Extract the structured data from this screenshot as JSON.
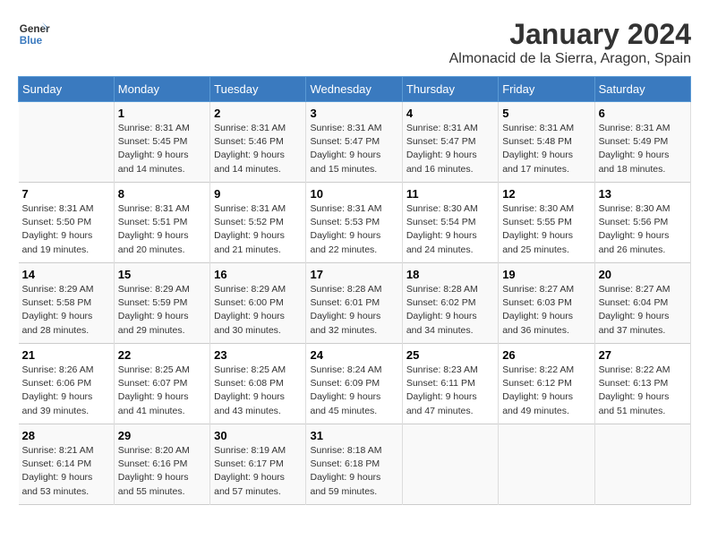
{
  "header": {
    "logo_general": "General",
    "logo_blue": "Blue",
    "month_year": "January 2024",
    "location": "Almonacid de la Sierra, Aragon, Spain"
  },
  "weekdays": [
    "Sunday",
    "Monday",
    "Tuesday",
    "Wednesday",
    "Thursday",
    "Friday",
    "Saturday"
  ],
  "weeks": [
    [
      {
        "day": "",
        "info": ""
      },
      {
        "day": "1",
        "info": "Sunrise: 8:31 AM\nSunset: 5:45 PM\nDaylight: 9 hours\nand 14 minutes."
      },
      {
        "day": "2",
        "info": "Sunrise: 8:31 AM\nSunset: 5:46 PM\nDaylight: 9 hours\nand 14 minutes."
      },
      {
        "day": "3",
        "info": "Sunrise: 8:31 AM\nSunset: 5:47 PM\nDaylight: 9 hours\nand 15 minutes."
      },
      {
        "day": "4",
        "info": "Sunrise: 8:31 AM\nSunset: 5:47 PM\nDaylight: 9 hours\nand 16 minutes."
      },
      {
        "day": "5",
        "info": "Sunrise: 8:31 AM\nSunset: 5:48 PM\nDaylight: 9 hours\nand 17 minutes."
      },
      {
        "day": "6",
        "info": "Sunrise: 8:31 AM\nSunset: 5:49 PM\nDaylight: 9 hours\nand 18 minutes."
      }
    ],
    [
      {
        "day": "7",
        "info": "Sunrise: 8:31 AM\nSunset: 5:50 PM\nDaylight: 9 hours\nand 19 minutes."
      },
      {
        "day": "8",
        "info": "Sunrise: 8:31 AM\nSunset: 5:51 PM\nDaylight: 9 hours\nand 20 minutes."
      },
      {
        "day": "9",
        "info": "Sunrise: 8:31 AM\nSunset: 5:52 PM\nDaylight: 9 hours\nand 21 minutes."
      },
      {
        "day": "10",
        "info": "Sunrise: 8:31 AM\nSunset: 5:53 PM\nDaylight: 9 hours\nand 22 minutes."
      },
      {
        "day": "11",
        "info": "Sunrise: 8:30 AM\nSunset: 5:54 PM\nDaylight: 9 hours\nand 24 minutes."
      },
      {
        "day": "12",
        "info": "Sunrise: 8:30 AM\nSunset: 5:55 PM\nDaylight: 9 hours\nand 25 minutes."
      },
      {
        "day": "13",
        "info": "Sunrise: 8:30 AM\nSunset: 5:56 PM\nDaylight: 9 hours\nand 26 minutes."
      }
    ],
    [
      {
        "day": "14",
        "info": "Sunrise: 8:29 AM\nSunset: 5:58 PM\nDaylight: 9 hours\nand 28 minutes."
      },
      {
        "day": "15",
        "info": "Sunrise: 8:29 AM\nSunset: 5:59 PM\nDaylight: 9 hours\nand 29 minutes."
      },
      {
        "day": "16",
        "info": "Sunrise: 8:29 AM\nSunset: 6:00 PM\nDaylight: 9 hours\nand 30 minutes."
      },
      {
        "day": "17",
        "info": "Sunrise: 8:28 AM\nSunset: 6:01 PM\nDaylight: 9 hours\nand 32 minutes."
      },
      {
        "day": "18",
        "info": "Sunrise: 8:28 AM\nSunset: 6:02 PM\nDaylight: 9 hours\nand 34 minutes."
      },
      {
        "day": "19",
        "info": "Sunrise: 8:27 AM\nSunset: 6:03 PM\nDaylight: 9 hours\nand 36 minutes."
      },
      {
        "day": "20",
        "info": "Sunrise: 8:27 AM\nSunset: 6:04 PM\nDaylight: 9 hours\nand 37 minutes."
      }
    ],
    [
      {
        "day": "21",
        "info": "Sunrise: 8:26 AM\nSunset: 6:06 PM\nDaylight: 9 hours\nand 39 minutes."
      },
      {
        "day": "22",
        "info": "Sunrise: 8:25 AM\nSunset: 6:07 PM\nDaylight: 9 hours\nand 41 minutes."
      },
      {
        "day": "23",
        "info": "Sunrise: 8:25 AM\nSunset: 6:08 PM\nDaylight: 9 hours\nand 43 minutes."
      },
      {
        "day": "24",
        "info": "Sunrise: 8:24 AM\nSunset: 6:09 PM\nDaylight: 9 hours\nand 45 minutes."
      },
      {
        "day": "25",
        "info": "Sunrise: 8:23 AM\nSunset: 6:11 PM\nDaylight: 9 hours\nand 47 minutes."
      },
      {
        "day": "26",
        "info": "Sunrise: 8:22 AM\nSunset: 6:12 PM\nDaylight: 9 hours\nand 49 minutes."
      },
      {
        "day": "27",
        "info": "Sunrise: 8:22 AM\nSunset: 6:13 PM\nDaylight: 9 hours\nand 51 minutes."
      }
    ],
    [
      {
        "day": "28",
        "info": "Sunrise: 8:21 AM\nSunset: 6:14 PM\nDaylight: 9 hours\nand 53 minutes."
      },
      {
        "day": "29",
        "info": "Sunrise: 8:20 AM\nSunset: 6:16 PM\nDaylight: 9 hours\nand 55 minutes."
      },
      {
        "day": "30",
        "info": "Sunrise: 8:19 AM\nSunset: 6:17 PM\nDaylight: 9 hours\nand 57 minutes."
      },
      {
        "day": "31",
        "info": "Sunrise: 8:18 AM\nSunset: 6:18 PM\nDaylight: 9 hours\nand 59 minutes."
      },
      {
        "day": "",
        "info": ""
      },
      {
        "day": "",
        "info": ""
      },
      {
        "day": "",
        "info": ""
      }
    ]
  ]
}
